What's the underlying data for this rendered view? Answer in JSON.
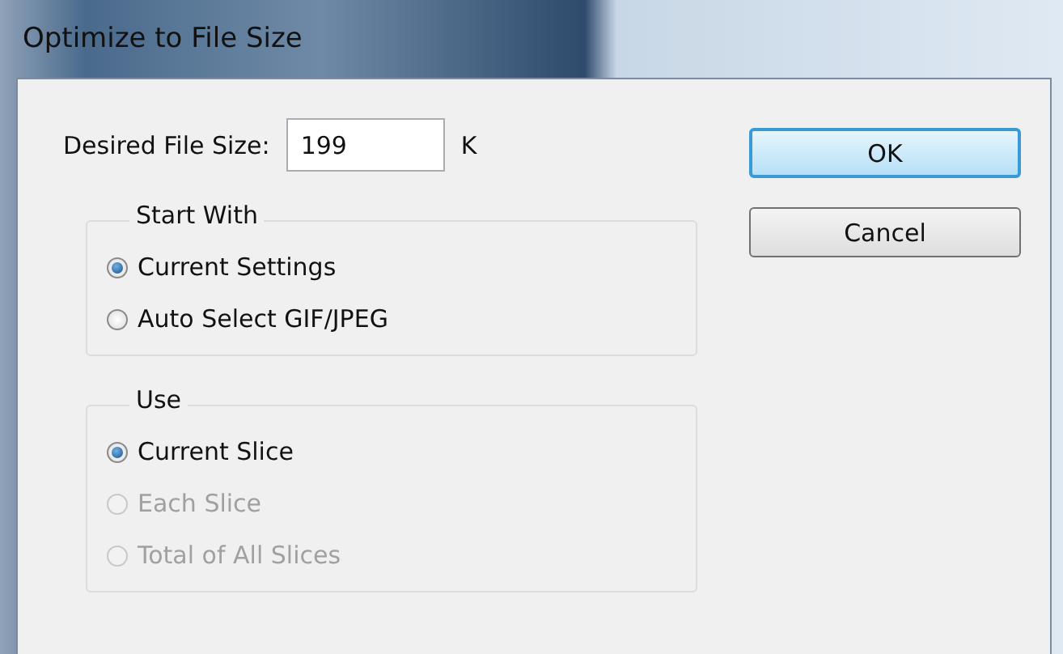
{
  "window": {
    "title": "Optimize to File Size"
  },
  "file_size": {
    "label": "Desired File Size:",
    "value": "199",
    "unit": "K"
  },
  "groups": [
    {
      "title": "Start With",
      "options": [
        {
          "label": "Current Settings",
          "selected": true,
          "disabled": false
        },
        {
          "label": "Auto Select GIF/JPEG",
          "selected": false,
          "disabled": false
        }
      ]
    },
    {
      "title": "Use",
      "options": [
        {
          "label": "Current Slice",
          "selected": true,
          "disabled": false
        },
        {
          "label": "Each Slice",
          "selected": false,
          "disabled": true
        },
        {
          "label": "Total of All Slices",
          "selected": false,
          "disabled": true
        }
      ]
    }
  ],
  "buttons": [
    {
      "label": "OK",
      "default": true
    },
    {
      "label": "Cancel",
      "default": false
    }
  ]
}
